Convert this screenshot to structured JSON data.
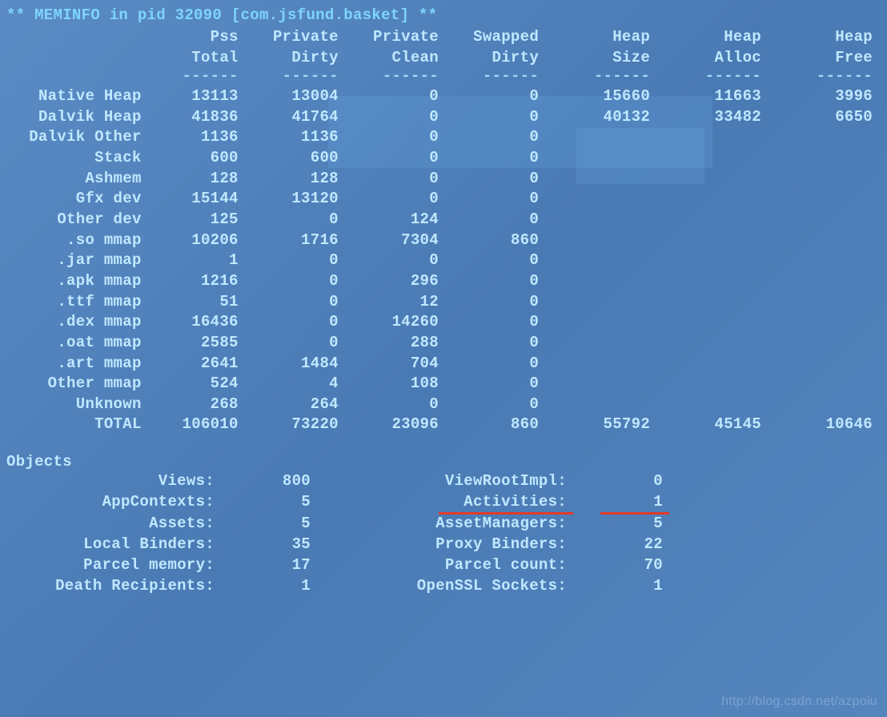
{
  "title": "** MEMINFO in pid 32090 [com.jsfund.basket] **",
  "headers": {
    "row1": [
      "Pss",
      "Private",
      "Private",
      "Swapped",
      "Heap",
      "Heap",
      "Heap"
    ],
    "row2": [
      "Total",
      "Dirty",
      "Clean",
      "Dirty",
      "Size",
      "Alloc",
      "Free"
    ]
  },
  "sep": "------",
  "rows": [
    {
      "label": "Native Heap",
      "c": [
        "13113",
        "13004",
        "0",
        "0",
        "15660",
        "11663",
        "3996"
      ]
    },
    {
      "label": "Dalvik Heap",
      "c": [
        "41836",
        "41764",
        "0",
        "0",
        "40132",
        "33482",
        "6650"
      ]
    },
    {
      "label": "Dalvik Other",
      "c": [
        "1136",
        "1136",
        "0",
        "0",
        "",
        "",
        ""
      ]
    },
    {
      "label": "Stack",
      "c": [
        "600",
        "600",
        "0",
        "0",
        "",
        "",
        ""
      ]
    },
    {
      "label": "Ashmem",
      "c": [
        "128",
        "128",
        "0",
        "0",
        "",
        "",
        ""
      ]
    },
    {
      "label": "Gfx dev",
      "c": [
        "15144",
        "13120",
        "0",
        "0",
        "",
        "",
        ""
      ]
    },
    {
      "label": "Other dev",
      "c": [
        "125",
        "0",
        "124",
        "0",
        "",
        "",
        ""
      ]
    },
    {
      "label": ".so mmap",
      "c": [
        "10206",
        "1716",
        "7304",
        "860",
        "",
        "",
        ""
      ]
    },
    {
      "label": ".jar mmap",
      "c": [
        "1",
        "0",
        "0",
        "0",
        "",
        "",
        ""
      ]
    },
    {
      "label": ".apk mmap",
      "c": [
        "1216",
        "0",
        "296",
        "0",
        "",
        "",
        ""
      ]
    },
    {
      "label": ".ttf mmap",
      "c": [
        "51",
        "0",
        "12",
        "0",
        "",
        "",
        ""
      ]
    },
    {
      "label": ".dex mmap",
      "c": [
        "16436",
        "0",
        "14260",
        "0",
        "",
        "",
        ""
      ]
    },
    {
      "label": ".oat mmap",
      "c": [
        "2585",
        "0",
        "288",
        "0",
        "",
        "",
        ""
      ]
    },
    {
      "label": ".art mmap",
      "c": [
        "2641",
        "1484",
        "704",
        "0",
        "",
        "",
        ""
      ]
    },
    {
      "label": "Other mmap",
      "c": [
        "524",
        "4",
        "108",
        "0",
        "",
        "",
        ""
      ]
    },
    {
      "label": "Unknown",
      "c": [
        "268",
        "264",
        "0",
        "0",
        "",
        "",
        ""
      ]
    },
    {
      "label": "TOTAL",
      "c": [
        "106010",
        "73220",
        "23096",
        "860",
        "55792",
        "45145",
        "10646"
      ]
    }
  ],
  "objects_title": "Objects",
  "objects": [
    {
      "l1": "Views:",
      "v1": "800",
      "l2": "ViewRootImpl:",
      "v2": "0",
      "hl": false
    },
    {
      "l1": "AppContexts:",
      "v1": "5",
      "l2": "Activities:",
      "v2": "1",
      "hl": true
    },
    {
      "l1": "Assets:",
      "v1": "5",
      "l2": "AssetManagers:",
      "v2": "5",
      "hl": false
    },
    {
      "l1": "Local Binders:",
      "v1": "35",
      "l2": "Proxy Binders:",
      "v2": "22",
      "hl": false
    },
    {
      "l1": "Parcel memory:",
      "v1": "17",
      "l2": "Parcel count:",
      "v2": "70",
      "hl": false
    },
    {
      "l1": "Death Recipients:",
      "v1": "1",
      "l2": "OpenSSL Sockets:",
      "v2": "1",
      "hl": false
    }
  ],
  "watermark": "http://blog.csdn.net/azpoiu"
}
